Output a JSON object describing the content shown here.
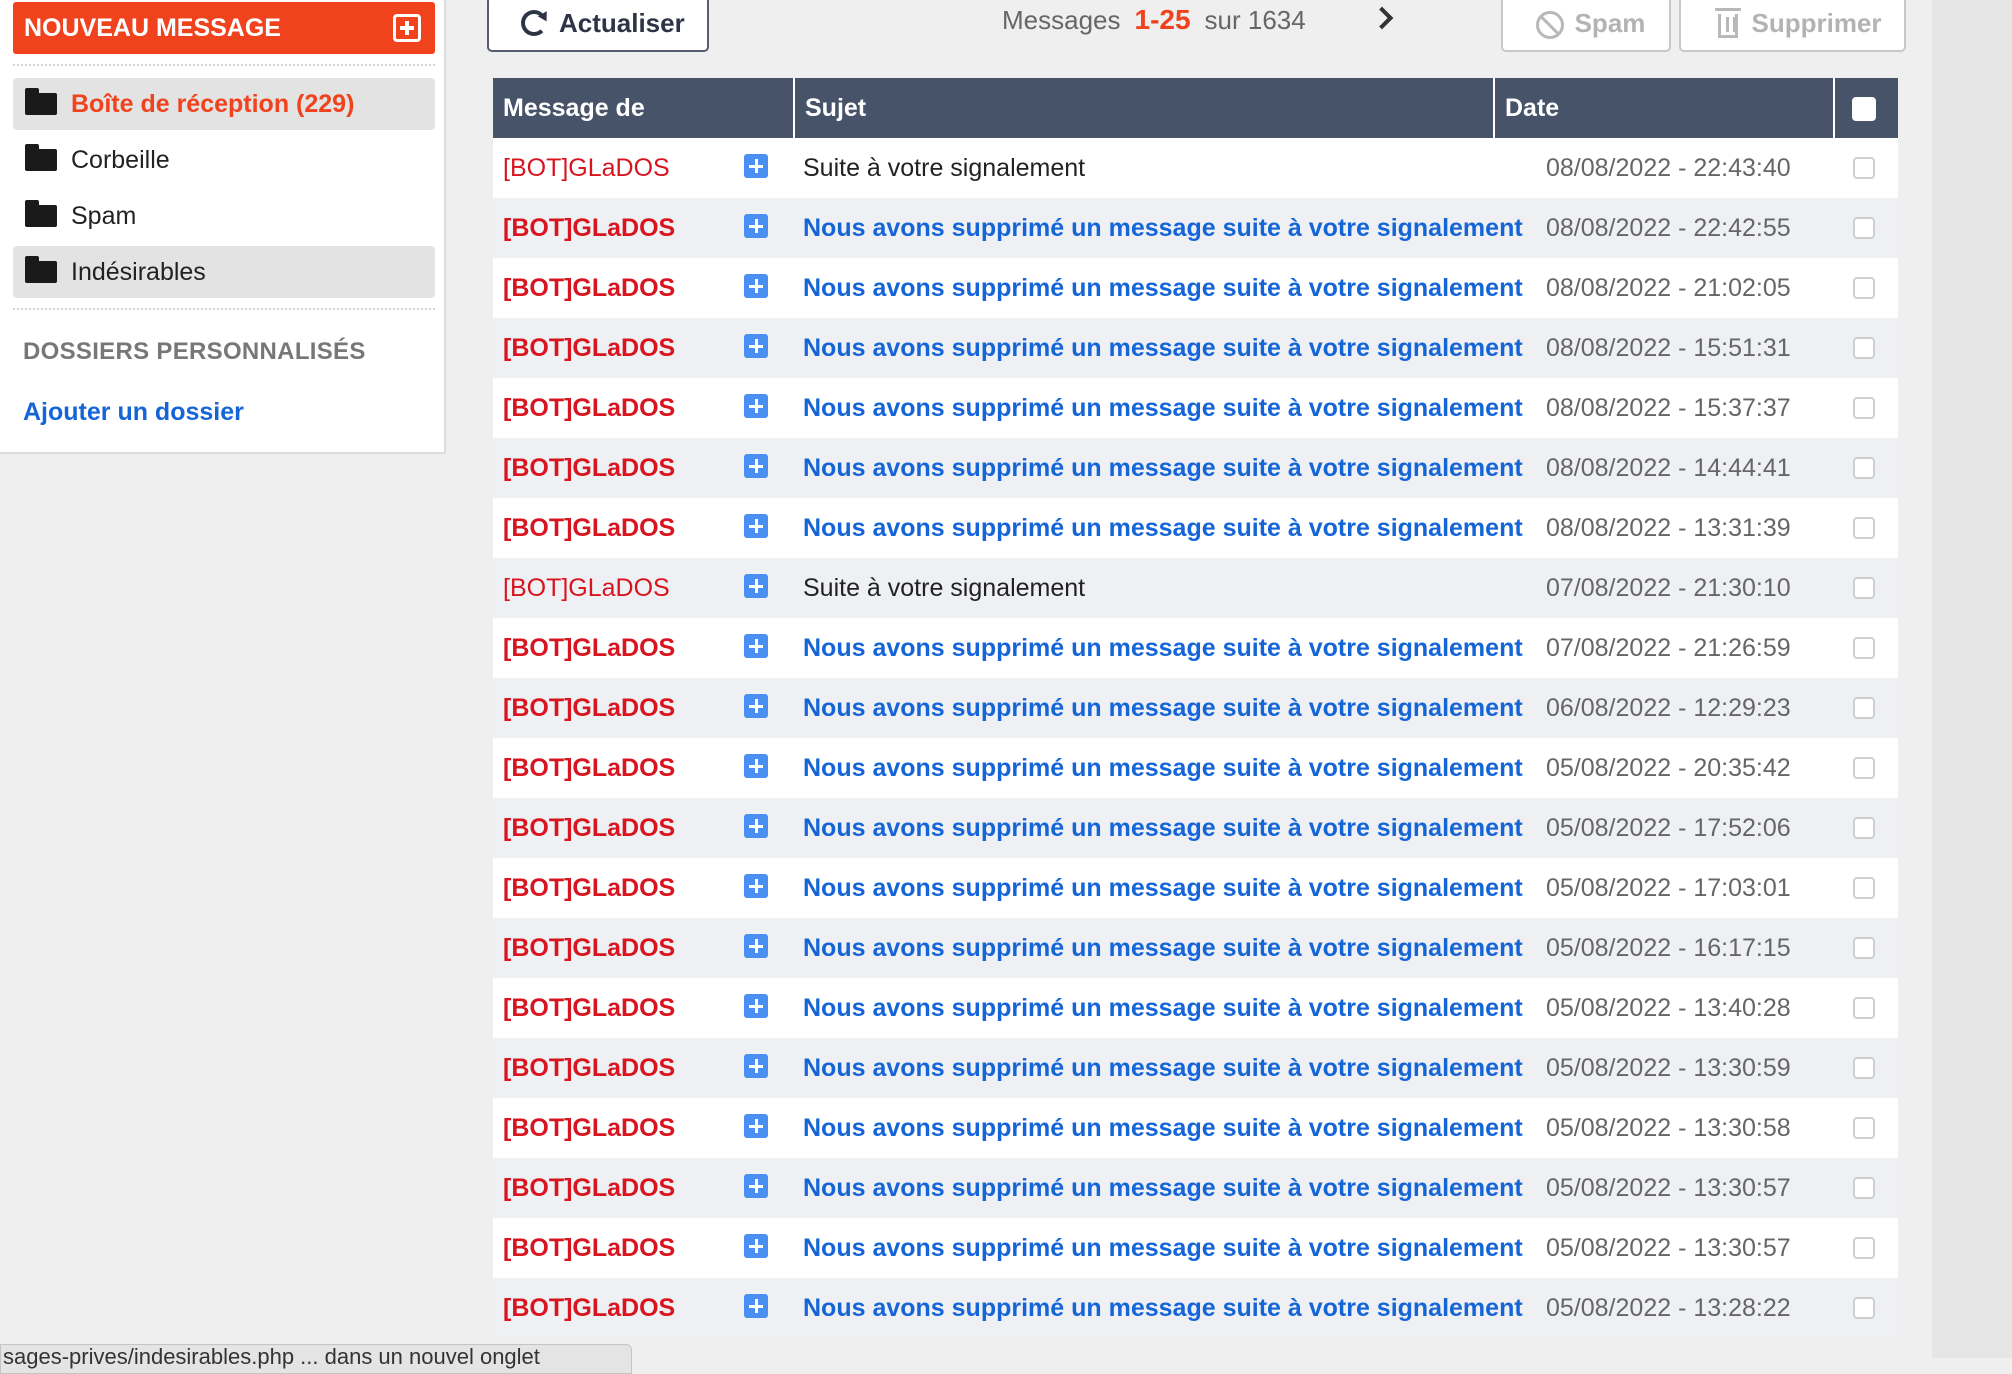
{
  "sidebar": {
    "new_message_label": "NOUVEAU MESSAGE",
    "folders": [
      {
        "label": "Boîte de réception (229)",
        "icon": "folder-icon",
        "active": true
      },
      {
        "label": "Corbeille",
        "icon": "folder-icon",
        "active": false
      },
      {
        "label": "Spam",
        "icon": "folder-icon",
        "active": false
      },
      {
        "label": "Indésirables",
        "icon": "folder-icon",
        "active": true
      }
    ],
    "custom_title": "DOSSIERS PERSONNALISÉS",
    "add_folder": "Ajouter un dossier"
  },
  "toolbar": {
    "refresh_label": "Actualiser",
    "pager_prefix": "Messages",
    "pager_range": "1-25",
    "pager_total": "sur 1634",
    "spam_label": "Spam",
    "delete_label": "Supprimer"
  },
  "table": {
    "headers": {
      "from": "Message de",
      "subject": "Sujet",
      "date": "Date"
    },
    "rows": [
      {
        "from": "[BOT]GLaDOS",
        "subject": "Suite à votre signalement",
        "date": "08/08/2022 - 22:43:40",
        "unread": false
      },
      {
        "from": "[BOT]GLaDOS",
        "subject": "Nous avons supprimé un message suite à votre signalement",
        "date": "08/08/2022 - 22:42:55",
        "unread": true
      },
      {
        "from": "[BOT]GLaDOS",
        "subject": "Nous avons supprimé un message suite à votre signalement",
        "date": "08/08/2022 - 21:02:05",
        "unread": true
      },
      {
        "from": "[BOT]GLaDOS",
        "subject": "Nous avons supprimé un message suite à votre signalement",
        "date": "08/08/2022 - 15:51:31",
        "unread": true
      },
      {
        "from": "[BOT]GLaDOS",
        "subject": "Nous avons supprimé un message suite à votre signalement",
        "date": "08/08/2022 - 15:37:37",
        "unread": true
      },
      {
        "from": "[BOT]GLaDOS",
        "subject": "Nous avons supprimé un message suite à votre signalement",
        "date": "08/08/2022 - 14:44:41",
        "unread": true
      },
      {
        "from": "[BOT]GLaDOS",
        "subject": "Nous avons supprimé un message suite à votre signalement",
        "date": "08/08/2022 - 13:31:39",
        "unread": true
      },
      {
        "from": "[BOT]GLaDOS",
        "subject": "Suite à votre signalement",
        "date": "07/08/2022 - 21:30:10",
        "unread": false
      },
      {
        "from": "[BOT]GLaDOS",
        "subject": "Nous avons supprimé un message suite à votre signalement",
        "date": "07/08/2022 - 21:26:59",
        "unread": true
      },
      {
        "from": "[BOT]GLaDOS",
        "subject": "Nous avons supprimé un message suite à votre signalement",
        "date": "06/08/2022 - 12:29:23",
        "unread": true
      },
      {
        "from": "[BOT]GLaDOS",
        "subject": "Nous avons supprimé un message suite à votre signalement",
        "date": "05/08/2022 - 20:35:42",
        "unread": true
      },
      {
        "from": "[BOT]GLaDOS",
        "subject": "Nous avons supprimé un message suite à votre signalement",
        "date": "05/08/2022 - 17:52:06",
        "unread": true
      },
      {
        "from": "[BOT]GLaDOS",
        "subject": "Nous avons supprimé un message suite à votre signalement",
        "date": "05/08/2022 - 17:03:01",
        "unread": true
      },
      {
        "from": "[BOT]GLaDOS",
        "subject": "Nous avons supprimé un message suite à votre signalement",
        "date": "05/08/2022 - 16:17:15",
        "unread": true
      },
      {
        "from": "[BOT]GLaDOS",
        "subject": "Nous avons supprimé un message suite à votre signalement",
        "date": "05/08/2022 - 13:40:28",
        "unread": true
      },
      {
        "from": "[BOT]GLaDOS",
        "subject": "Nous avons supprimé un message suite à votre signalement",
        "date": "05/08/2022 - 13:30:59",
        "unread": true
      },
      {
        "from": "[BOT]GLaDOS",
        "subject": "Nous avons supprimé un message suite à votre signalement",
        "date": "05/08/2022 - 13:30:58",
        "unread": true
      },
      {
        "from": "[BOT]GLaDOS",
        "subject": "Nous avons supprimé un message suite à votre signalement",
        "date": "05/08/2022 - 13:30:57",
        "unread": true
      },
      {
        "from": "[BOT]GLaDOS",
        "subject": "Nous avons supprimé un message suite à votre signalement",
        "date": "05/08/2022 - 13:30:57",
        "unread": true
      },
      {
        "from": "[BOT]GLaDOS",
        "subject": "Nous avons supprimé un message suite à votre signalement",
        "date": "05/08/2022 - 13:28:22",
        "unread": true
      }
    ]
  },
  "statusbar": {
    "text": "sages-prives/indesirables.php ... dans un nouvel onglet"
  },
  "colors": {
    "accent": "#f0421c",
    "header": "#475369",
    "link": "#1565d8",
    "sender": "#d8141f"
  }
}
